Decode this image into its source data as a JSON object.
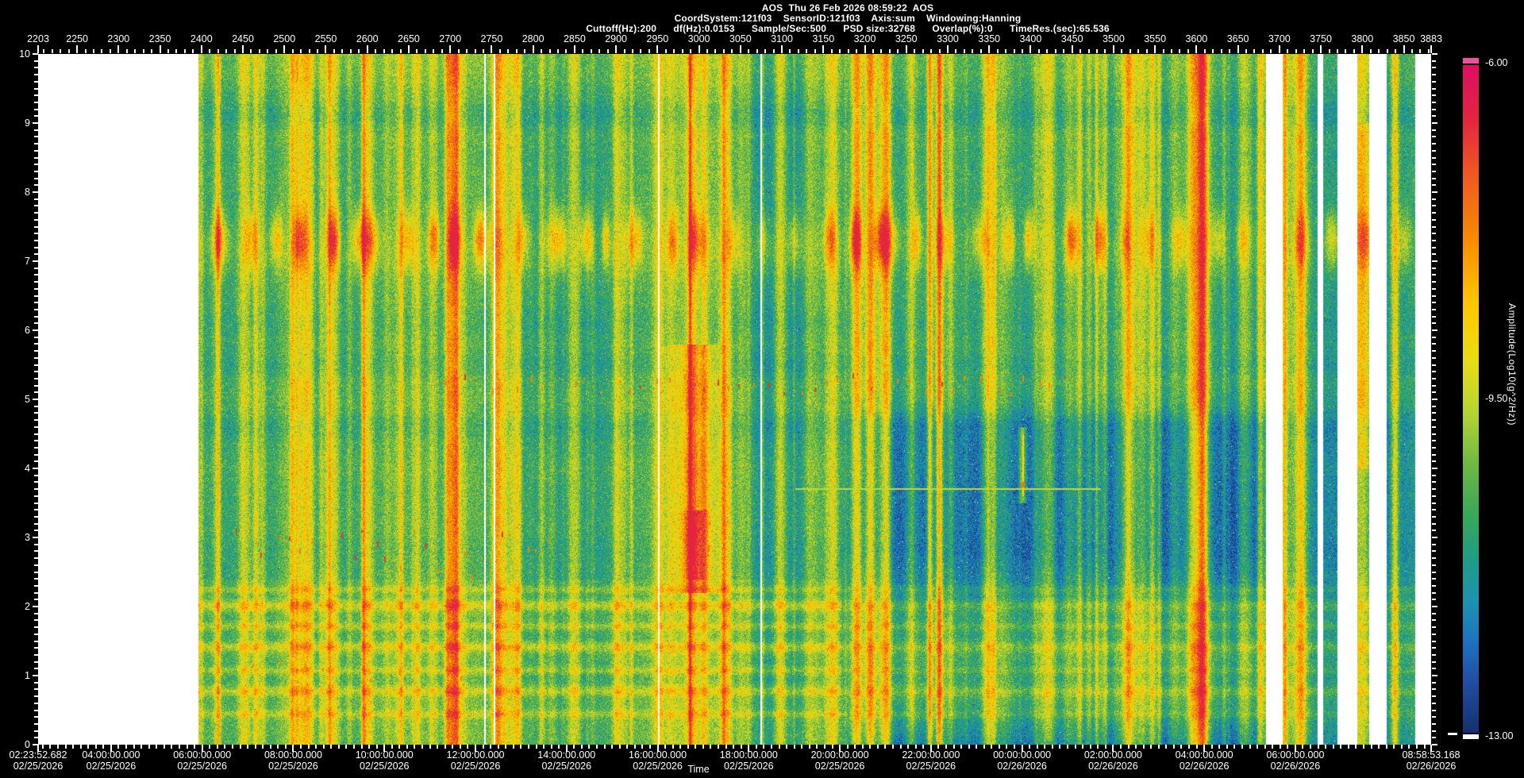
{
  "header": {
    "line1": "AOS  Thu 26 Feb 2026 08:59:22  AOS",
    "line2": "CoordSystem:121f03    SensorID:121f03    Axis:sum    Windowing:Hanning",
    "line3": "Cuttoff(Hz):200      df(Hz):0.0153      Sample/Sec:500      PSD size:32768      Overlap(%):0      TimeRes.(sec):65.536"
  },
  "axes": {
    "top": {
      "min": 2203,
      "max": 3883,
      "minor_step": 10,
      "tick_values": [
        2203,
        2250,
        2300,
        2350,
        2400,
        2450,
        2500,
        2550,
        2600,
        2650,
        2700,
        2750,
        2800,
        2850,
        2900,
        2950,
        3000,
        3050,
        3100,
        3150,
        3200,
        3250,
        3300,
        3350,
        3400,
        3450,
        3500,
        3550,
        3600,
        3650,
        3700,
        3750,
        3800,
        3850,
        3883
      ]
    },
    "left": {
      "min": 0,
      "max": 10,
      "tick_values": [
        10,
        9,
        8,
        7,
        6,
        5,
        4,
        3,
        2,
        1,
        0
      ],
      "minor_step": 0.1
    },
    "bottom": {
      "title": "Time",
      "minor_step_seconds": 600,
      "ticks": [
        {
          "time": "02:23:52.682",
          "date": "02/25/2026"
        },
        {
          "time": "04:00:00.000",
          "date": "02/25/2026"
        },
        {
          "time": "06:00:00.000",
          "date": "02/25/2026"
        },
        {
          "time": "08:00:00.000",
          "date": "02/25/2026"
        },
        {
          "time": "10:00:00.000",
          "date": "02/25/2026"
        },
        {
          "time": "12:00:00.000",
          "date": "02/25/2026"
        },
        {
          "time": "14:00:00.000",
          "date": "02/25/2026"
        },
        {
          "time": "16:00:00.000",
          "date": "02/25/2026"
        },
        {
          "time": "18:00:00.000",
          "date": "02/25/2026"
        },
        {
          "time": "20:00:00.000",
          "date": "02/25/2026"
        },
        {
          "time": "22:00:00.000",
          "date": "02/25/2026"
        },
        {
          "time": "00:00:00.000",
          "date": "02/26/2026"
        },
        {
          "time": "02:00:00.000",
          "date": "02/26/2026"
        },
        {
          "time": "04:00:00.000",
          "date": "02/26/2026"
        },
        {
          "time": "06:00:00.000",
          "date": "02/26/2026"
        },
        {
          "time": "08:58:53.168",
          "date": "02/26/2026"
        }
      ]
    }
  },
  "colorbar": {
    "title": "Amplitude(Log10(g^2/Hz))",
    "labels": [
      "-6.00",
      "-9.50",
      "-13.00"
    ],
    "max": -6.0,
    "mid": -9.5,
    "min": -13.0,
    "over_color": "#f0529c",
    "under_color": "#ffffff",
    "gradient": [
      {
        "p": 0.0,
        "c": "#dc0f63"
      },
      {
        "p": 0.08,
        "c": "#e42440"
      },
      {
        "p": 0.16,
        "c": "#ee5722"
      },
      {
        "p": 0.26,
        "c": "#f68b00"
      },
      {
        "p": 0.36,
        "c": "#fdc800"
      },
      {
        "p": 0.44,
        "c": "#e8dc16"
      },
      {
        "p": 0.52,
        "c": "#b5d431"
      },
      {
        "p": 0.6,
        "c": "#6cb843"
      },
      {
        "p": 0.68,
        "c": "#35a65c"
      },
      {
        "p": 0.74,
        "c": "#1f9d85"
      },
      {
        "p": 0.8,
        "c": "#1b94ae"
      },
      {
        "p": 0.86,
        "c": "#1e74c0"
      },
      {
        "p": 0.92,
        "c": "#2150a4"
      },
      {
        "p": 1.0,
        "c": "#15306e"
      }
    ]
  },
  "chart_data": {
    "type": "heatmap",
    "title": "AOS  Thu 26 Feb 2026 08:59:22  AOS",
    "x_top_axis": {
      "min": 2203,
      "max": 3883,
      "tick_step": 50,
      "first_tick": 2203,
      "last_tick": 3883
    },
    "x_time_axis": {
      "start": "02/25/2026 02:23:52.682",
      "end": "02/26/2026 08:58:53.168",
      "label": "Time",
      "tick_interval_hours": 2
    },
    "y_axis": {
      "min": 0,
      "max": 10
    },
    "color_axis": {
      "label": "Amplitude(Log10(g^2/Hz))",
      "max": -6.0,
      "mid": -9.5,
      "min": -13.0
    },
    "data_gaps_records": [
      [
        2203,
        2396
      ],
      [
        3684,
        3704
      ],
      [
        3746,
        3753
      ],
      [
        3770,
        3794
      ],
      [
        3808,
        3829
      ],
      [
        3864,
        3883
      ]
    ],
    "thin_gap_records": [
      2741,
      2752,
      2951,
      3074
    ],
    "features": [
      "teal-green broadband noise field with vertical yellow high-energy streaks across full band",
      "repeating yellow blob band centered near 7.3 on the y-axis across entire record",
      "horizontal yellow-green striping below y=2.3, strongest on left half",
      "bright yellow column near record 3000 spanning y 2.2-5.8 with orange-red core",
      "darker blue region records ~3170-3684 between y 2.2-4.9 and below y 0.7",
      "thin continuous yellow horizontal line at y=3.71 from record ~3116 to ~3485",
      "scattered orange-red specks near y=5.2 and y=2.4-3.2",
      "bright narrow yellow column at record ~3706 and orange column near record 3800"
    ]
  }
}
